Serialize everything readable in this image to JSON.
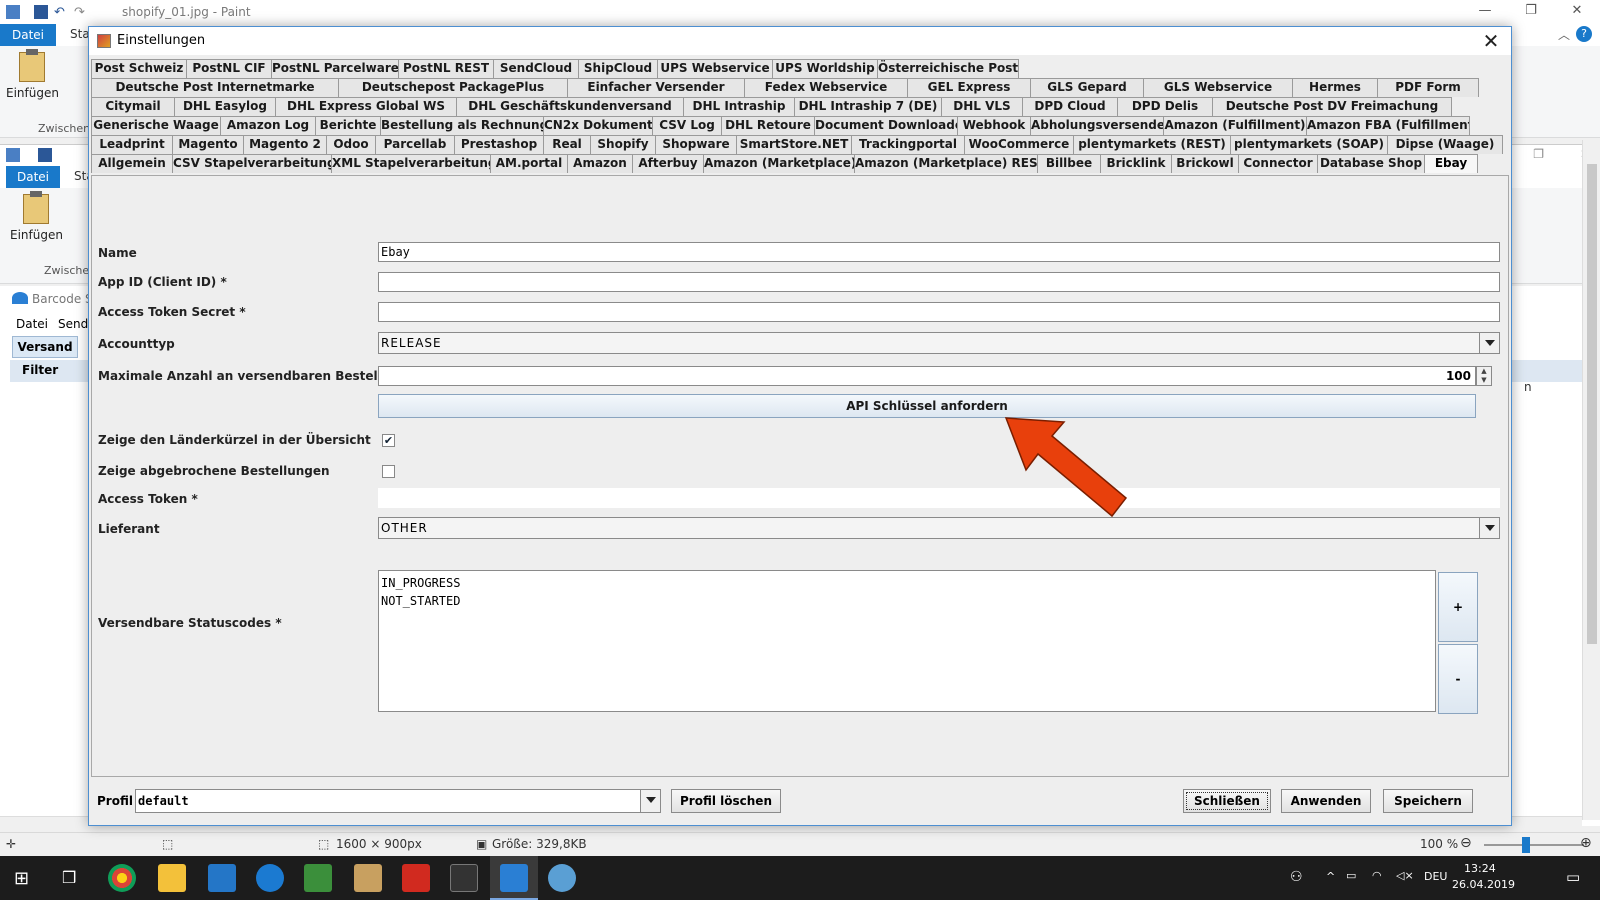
{
  "paint": {
    "title": "shopify_01.jpg - Paint",
    "tab_file": "Datei",
    "tab_start": "Sta",
    "paste": "Einfügen",
    "clipboard_group": "Zwischen",
    "status_dims": "1600 × 900px",
    "status_size": "Größe: 329,8KB",
    "zoom": "100 %"
  },
  "app2": {
    "tab_file": "Datei",
    "tab_start": "Sta",
    "paste": "Einfügen",
    "clipboard_group": "Zwischen"
  },
  "app3": {
    "title": "Barcode S",
    "menu": [
      "Datei",
      "Send"
    ],
    "tab": "Versand",
    "filter": "Filter",
    "col_fragment": "n"
  },
  "dialog": {
    "title": "Einstellungen",
    "tab_rows": [
      [
        {
          "label": "Post Schweiz",
          "w": 96
        },
        {
          "label": "PostNL CIF",
          "w": 86
        },
        {
          "label": "PostNL Parcelware",
          "w": 128
        },
        {
          "label": "PostNL REST",
          "w": 96
        },
        {
          "label": "SendCloud",
          "w": 86
        },
        {
          "label": "ShipCloud",
          "w": 80
        },
        {
          "label": "UPS Webservice",
          "w": 116
        },
        {
          "label": "UPS Worldship",
          "w": 106
        },
        {
          "label": "Österreichische Post",
          "w": 142
        }
      ],
      [
        {
          "label": "Deutsche Post Internetmarke",
          "w": 248
        },
        {
          "label": "Deutschepost PackagePlus",
          "w": 230
        },
        {
          "label": "Einfacher Versender",
          "w": 178
        },
        {
          "label": "Fedex Webservice",
          "w": 164
        },
        {
          "label": "GEL Express",
          "w": 124
        },
        {
          "label": "GLS Gepard",
          "w": 114
        },
        {
          "label": "GLS Webservice",
          "w": 150
        },
        {
          "label": "Hermes",
          "w": 86
        },
        {
          "label": "PDF Form",
          "w": 102
        }
      ],
      [
        {
          "label": "Citymail",
          "w": 84
        },
        {
          "label": "DHL Easylog",
          "w": 102
        },
        {
          "label": "DHL Express Global WS",
          "w": 182
        },
        {
          "label": "DHL Geschäftskundenversand",
          "w": 228
        },
        {
          "label": "DHL Intraship",
          "w": 112
        },
        {
          "label": "DHL Intraship 7 (DE)",
          "w": 148
        },
        {
          "label": "DHL VLS",
          "w": 82
        },
        {
          "label": "DPD Cloud",
          "w": 96
        },
        {
          "label": "DPD Delis",
          "w": 96
        },
        {
          "label": "Deutsche Post DV Freimachung",
          "w": 240
        }
      ],
      [
        {
          "label": "Generische Waage",
          "w": 130
        },
        {
          "label": "Amazon Log",
          "w": 96
        },
        {
          "label": "Berichte",
          "w": 66
        },
        {
          "label": "Bestellung als Rechnung",
          "w": 164
        },
        {
          "label": "CN2x Dokument",
          "w": 110
        },
        {
          "label": "CSV Log",
          "w": 70
        },
        {
          "label": "DHL Retoure",
          "w": 94
        },
        {
          "label": "Document Downloader",
          "w": 144
        },
        {
          "label": "Webhook",
          "w": 74
        },
        {
          "label": "Abholungsversender",
          "w": 134
        },
        {
          "label": "Amazon (Fulfillment)",
          "w": 144
        },
        {
          "label": "Amazon FBA (Fulfillment)",
          "w": 164
        }
      ],
      [
        {
          "label": "Leadprint",
          "w": 82
        },
        {
          "label": "Magento",
          "w": 72
        },
        {
          "label": "Magento 2",
          "w": 84
        },
        {
          "label": "Odoo",
          "w": 50
        },
        {
          "label": "Parcellab",
          "w": 80
        },
        {
          "label": "Prestashop",
          "w": 90
        },
        {
          "label": "Real",
          "w": 48
        },
        {
          "label": "Shopify",
          "w": 66
        },
        {
          "label": "Shopware",
          "w": 82
        },
        {
          "label": "SmartStore.NET",
          "w": 116
        },
        {
          "label": "Trackingportal",
          "w": 114
        },
        {
          "label": "WooCommerce",
          "w": 110
        },
        {
          "label": "plentymarkets (REST)",
          "w": 158
        },
        {
          "label": "plentymarkets (SOAP)",
          "w": 158
        },
        {
          "label": "Dipse (Waage)",
          "w": 116
        }
      ],
      [
        {
          "label": "Allgemein",
          "w": 82
        },
        {
          "label": "CSV Stapelverarbeitung",
          "w": 160
        },
        {
          "label": "XML Stapelverarbeitung",
          "w": 160
        },
        {
          "label": "AM.portal",
          "w": 78
        },
        {
          "label": "Amazon",
          "w": 66
        },
        {
          "label": "Afterbuy",
          "w": 72
        },
        {
          "label": "Amazon (Marketplace)",
          "w": 152
        },
        {
          "label": "Amazon (Marketplace) REST",
          "w": 184
        },
        {
          "label": "Billbee",
          "w": 64
        },
        {
          "label": "Bricklink",
          "w": 72
        },
        {
          "label": "Brickowl",
          "w": 68
        },
        {
          "label": "Connector",
          "w": 80
        },
        {
          "label": "Database Shop",
          "w": 108
        },
        {
          "label": "Ebay",
          "w": 54,
          "active": true
        }
      ]
    ],
    "fields": {
      "name_label": "Name",
      "name_value": "Ebay",
      "appid_label": "App ID (Client ID) *",
      "appid_value": "",
      "secret_label": "Access Token Secret *",
      "secret_value": "",
      "accounttype_label": "Accounttyp",
      "accounttype_value": "RELEASE",
      "max_orders_label": "Maximale Anzahl an versendbaren Bestellungen",
      "max_orders_value": "100",
      "api_button": "API Schlüssel anfordern",
      "show_country_label": "Zeige den Länderkürzel in der Übersicht",
      "show_country_checked": true,
      "show_cancelled_label": "Zeige abgebrochene Bestellungen",
      "show_cancelled_checked": false,
      "access_token_label": "Access Token *",
      "access_token_value": "",
      "supplier_label": "Lieferant",
      "supplier_value": "OTHER",
      "status_codes_label": "Versendbare Statuscodes *",
      "status_codes": [
        "IN_PROGRESS",
        "NOT_STARTED"
      ],
      "add_button": "+",
      "remove_button": "-"
    },
    "bottom": {
      "profile_label": "Profil",
      "profile_value": "default",
      "delete_profile": "Profil löschen",
      "close": "Schließen",
      "apply": "Anwenden",
      "save": "Speichern"
    },
    "arrow_color": "#e8400c"
  },
  "taskbar": {
    "language": "DEU",
    "time": "13:24",
    "date": "26.04.2019"
  }
}
